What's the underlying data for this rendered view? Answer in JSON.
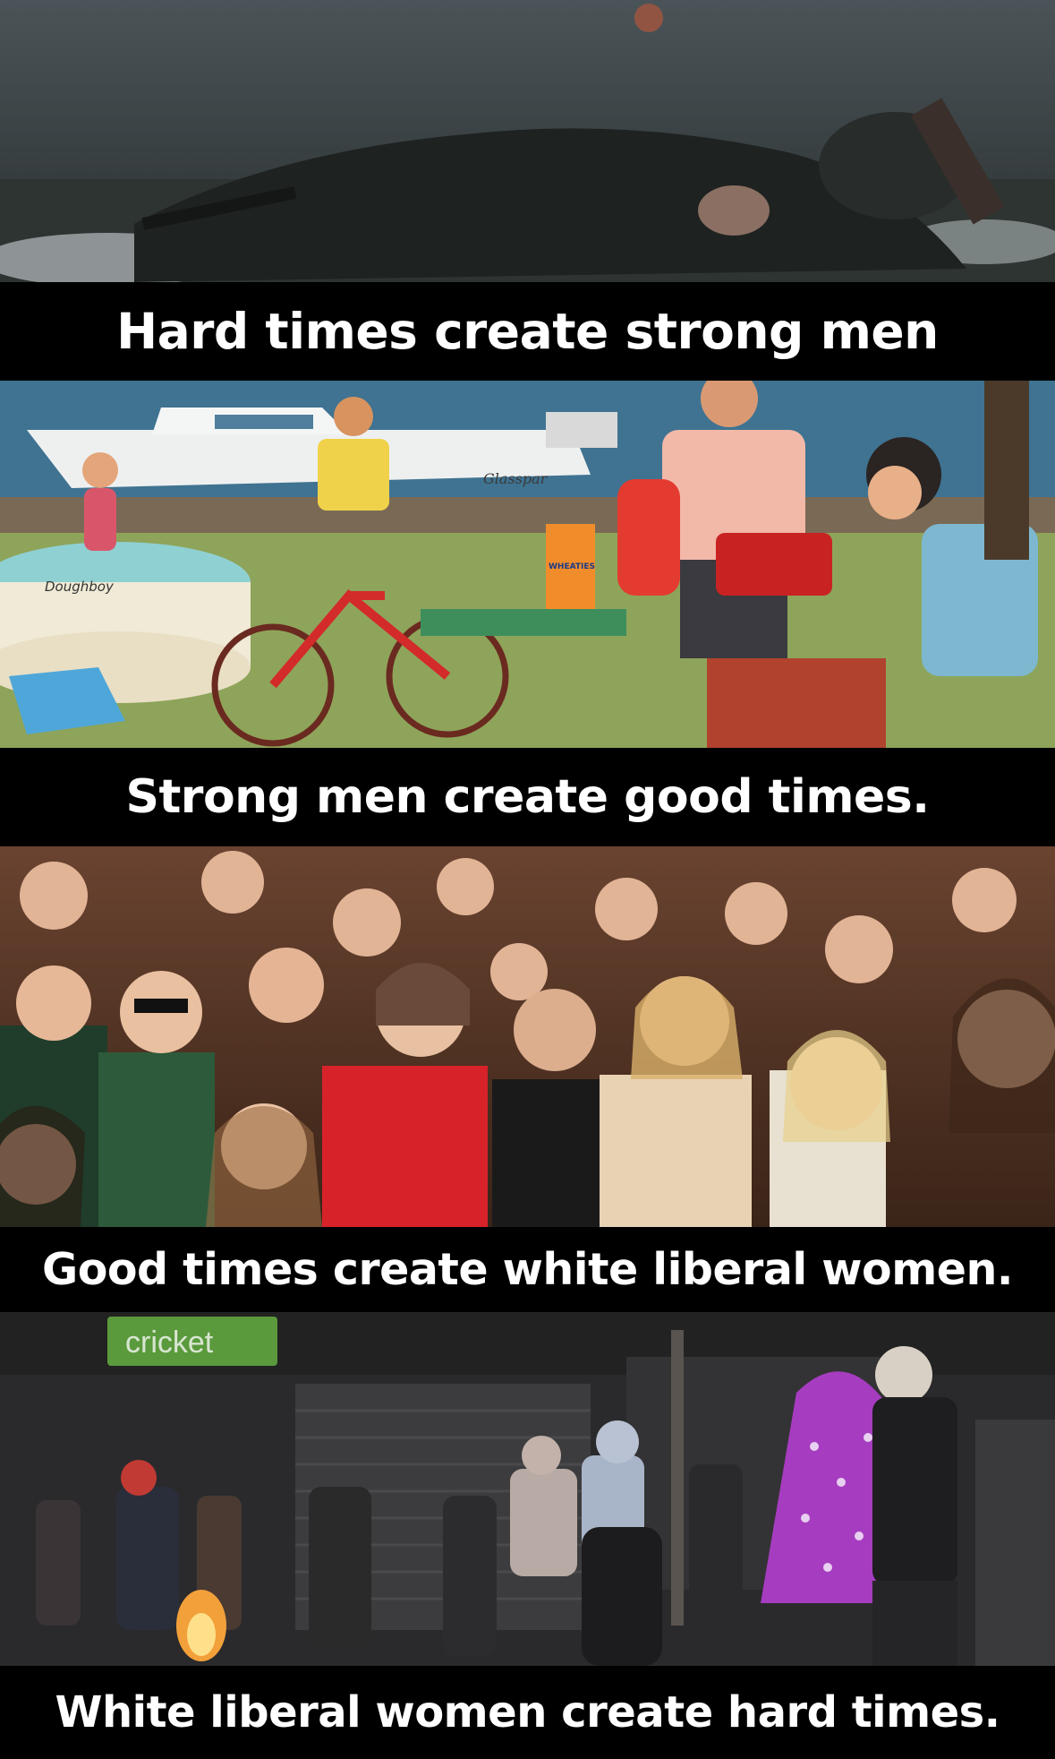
{
  "captions": [
    "Hard times create strong men",
    "Strong men create good times.",
    "Good times create white liberal women.",
    "White liberal women create hard times."
  ],
  "signs": {
    "boat_brand": "Glasspar",
    "pool_brand": "Doughboy",
    "cereal_box": "WHEATIES",
    "store_sign": "cricket"
  },
  "colors": {
    "caption_bg": "#000000",
    "caption_text": "#ffffff",
    "red_dress": "#d8222a",
    "cricket_green": "#5a9a3c"
  }
}
